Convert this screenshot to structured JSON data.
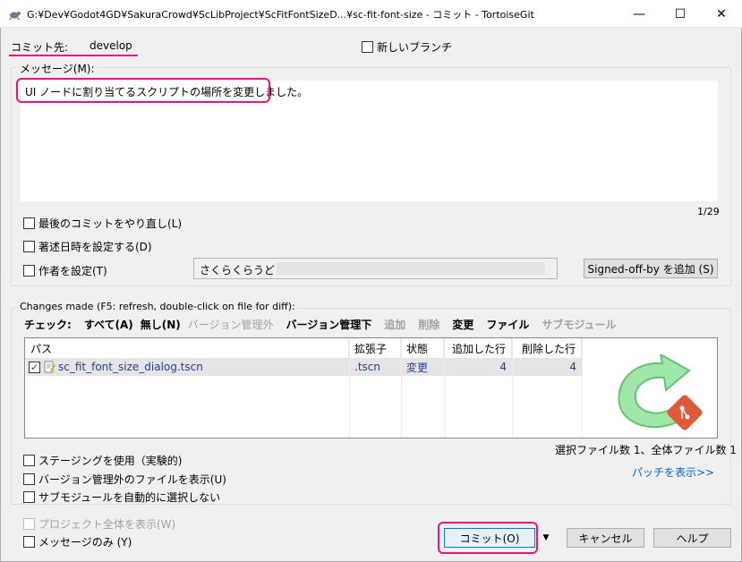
{
  "window": {
    "title": "G:¥Dev¥Godot4GD¥SakuraCrowd¥ScLibProject¥ScFitFontSizeD...¥sc-fit-font-size - コミット - TortoiseGit",
    "minimize_glyph": "—",
    "maximize_glyph": "☐",
    "close_glyph": "✕"
  },
  "commit_to": {
    "label": "コミット先:",
    "branch": "develop",
    "new_branch_label": "新しいブランチ"
  },
  "message": {
    "group_label": "メッセージ(M):",
    "text": "UI ノードに割り当てるスクリプトの場所を変更しました。",
    "counter": "1/29"
  },
  "options": {
    "amend_label": "最後のコミットをやり直し(L)",
    "set_date_label": "著述日時を設定する(D)",
    "set_author_label": "作者を設定(T)",
    "author_value": "さくらくらうど",
    "signed_off_label": "Signed-off-by を追加 (S)"
  },
  "changes": {
    "group_label": "Changes made (F5: refresh, double-click on file for diff):",
    "check_label": "チェック:",
    "filters": {
      "all": "すべて(A)",
      "none": "無し(N)",
      "unversioned": "バージョン管理外",
      "versioned": "バージョン管理下",
      "added": "追加",
      "deleted": "削除",
      "modified": "変更",
      "files": "ファイル",
      "submodules": "サブモジュール"
    },
    "columns": [
      "パス",
      "拡張子",
      "状態",
      "追加した行",
      "削除した行"
    ],
    "rows": [
      {
        "path": "sc_fit_font_size_dialog.tscn",
        "ext": ".tscn",
        "status": "変更",
        "added": "4",
        "deleted": "4",
        "checked": true
      }
    ],
    "summary": "選択ファイル数 1、全体ファイル数 1",
    "patch_link": "パッチを表示>>"
  },
  "bottom_options": {
    "staging_label": "ステージングを使用（実験的)",
    "show_unversioned_label": "バージョン管理外のファイルを表示(U)",
    "no_auto_submodule_label": "サブモジュールを自動的に選択しない",
    "show_whole_project_label": "プロジェクト全体を表示(W)",
    "message_only_label": "メッセージのみ (Y)"
  },
  "buttons": {
    "commit": "コミット(O)",
    "dropdown_glyph": "▼",
    "cancel": "キャンセル",
    "help": "ヘルプ"
  },
  "colors": {
    "highlight": "#e5177e",
    "link": "#0066cc",
    "logo_green": "#5fd36b",
    "logo_red": "#e05a3a"
  }
}
